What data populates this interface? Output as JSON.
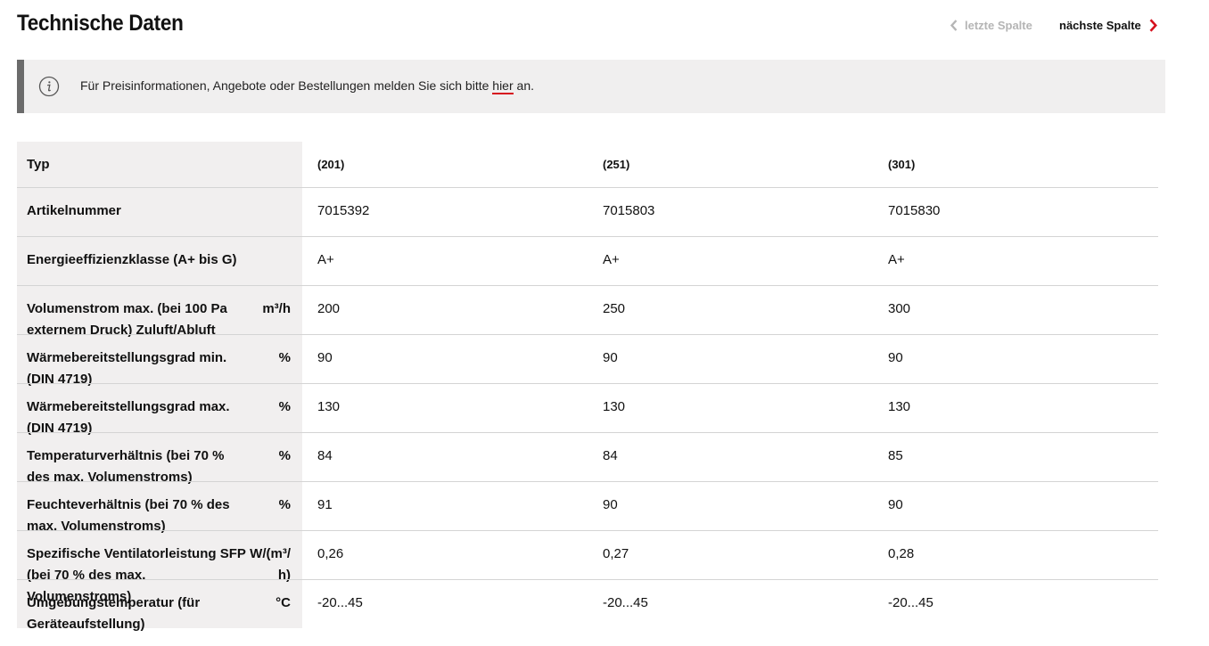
{
  "header": {
    "title": "Technische Daten",
    "prev_label": "letzte Spalte",
    "next_label": "nächste Spalte"
  },
  "notice": {
    "text_before": "Für Preisinformationen, Angebote oder Bestellungen melden Sie sich bitte ",
    "link_text": "hier",
    "text_after": " an."
  },
  "colors": {
    "accent": "#d6121f",
    "label_bg": "#f1efef",
    "notice_bg": "#f0efef"
  },
  "table": {
    "rows": [
      {
        "label": "Typ",
        "unit": "",
        "values": [
          "(201)",
          "(251)",
          "(301)"
        ]
      },
      {
        "label": "Artikelnummer",
        "unit": "",
        "values": [
          "7015392",
          "7015803",
          "7015830"
        ]
      },
      {
        "label": "Energieeffizienzklasse (A+ bis G)",
        "unit": "",
        "values": [
          "A+",
          "A+",
          "A+"
        ]
      },
      {
        "label": "Volumenstrom max. (bei 100 Pa externem Druck) Zuluft/Abluft",
        "unit": "m³/h",
        "values": [
          "200",
          "250",
          "300"
        ]
      },
      {
        "label": "Wärmebereitstellungsgrad min. (DIN 4719)",
        "unit": "%",
        "values": [
          "90",
          "90",
          "90"
        ]
      },
      {
        "label": "Wärmebereitstellungsgrad max. (DIN 4719)",
        "unit": "%",
        "values": [
          "130",
          "130",
          "130"
        ]
      },
      {
        "label": "Temperaturverhältnis (bei 70 % des max. Volumenstroms)",
        "unit": "%",
        "values": [
          "84",
          "84",
          "85"
        ]
      },
      {
        "label": "Feuchteverhältnis (bei 70 % des max. Volumenstroms)",
        "unit": "%",
        "values": [
          "91",
          "90",
          "90"
        ]
      },
      {
        "label": "Spezifische Ventilatorleistung SFP (bei 70 % des max. Volumenstroms)",
        "unit": "W/(m³/h)",
        "values": [
          "0,26",
          "0,27",
          "0,28"
        ]
      },
      {
        "label": "Umgebungstemperatur (für Geräteaufstellung)",
        "unit": "°C",
        "values": [
          "-20...45",
          "-20...45",
          "-20...45"
        ]
      }
    ]
  }
}
